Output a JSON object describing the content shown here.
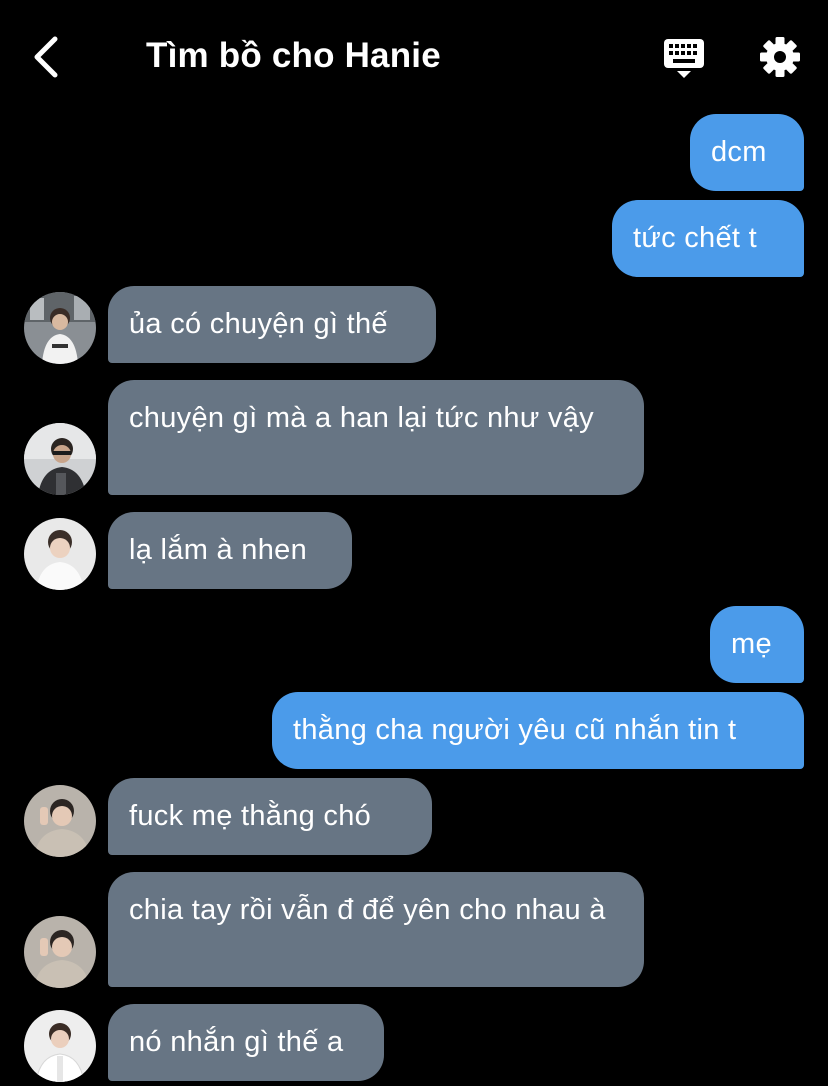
{
  "header": {
    "title": "Tìm bồ cho Hanie",
    "back_icon": "chevron-left-icon",
    "keyboard_icon": "keyboard-icon",
    "settings_icon": "gear-icon"
  },
  "colors": {
    "background": "#000000",
    "outgoing_bubble": "#4b9bea",
    "incoming_bubble": "#677584",
    "text": "#ffffff"
  },
  "messages": [
    {
      "direction": "outgoing",
      "text": "dcm"
    },
    {
      "direction": "outgoing",
      "text": "tức chết t"
    },
    {
      "direction": "incoming",
      "avatar": "avatar-1",
      "text": "ủa có chuyện gì thế"
    },
    {
      "direction": "incoming",
      "avatar": "avatar-2",
      "text": "chuyện gì mà a han lại tức như vậy"
    },
    {
      "direction": "incoming",
      "avatar": "avatar-3",
      "text": "lạ lắm à nhen"
    },
    {
      "direction": "outgoing",
      "text": "mẹ"
    },
    {
      "direction": "outgoing",
      "text": "thằng cha người yêu cũ nhắn tin t"
    },
    {
      "direction": "incoming",
      "avatar": "avatar-4",
      "text": "fuck mẹ thằng chó"
    },
    {
      "direction": "incoming",
      "avatar": "avatar-4",
      "text": "chia tay rồi vẫn đ để yên cho nhau à"
    },
    {
      "direction": "incoming",
      "avatar": "avatar-5",
      "text": "nó nhắn gì thế a"
    }
  ]
}
